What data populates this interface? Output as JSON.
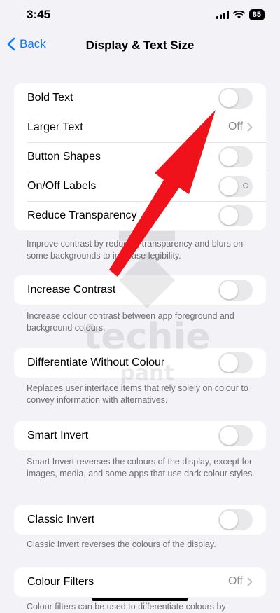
{
  "status": {
    "time": "3:45",
    "battery": "85"
  },
  "nav": {
    "back_label": "Back",
    "title": "Display & Text Size"
  },
  "group1": {
    "bold_text": "Bold Text",
    "larger_text": "Larger Text",
    "larger_text_value": "Off",
    "button_shapes": "Button Shapes",
    "onoff_labels": "On/Off Labels",
    "reduce_transparency": "Reduce Transparency",
    "footer": "Improve contrast by reducing transparency and blurs on some backgrounds to increase legibility."
  },
  "increase_contrast": {
    "label": "Increase Contrast",
    "footer": "Increase colour contrast between app foreground and background colours."
  },
  "differentiate": {
    "label": "Differentiate Without Colour",
    "footer": "Replaces user interface items that rely solely on colour to convey information with alternatives."
  },
  "smart_invert": {
    "label": "Smart Invert",
    "footer": "Smart Invert reverses the colours of the display, except for images, media, and some apps that use dark colour styles."
  },
  "classic_invert": {
    "label": "Classic Invert",
    "footer": "Classic Invert reverses the colours of the display."
  },
  "colour_filters": {
    "label": "Colour Filters",
    "value": "Off",
    "footer": "Colour filters can be used to differentiate colours by"
  },
  "toggles": {
    "bold_text": false,
    "button_shapes": false,
    "onoff_labels": false,
    "reduce_transparency": false,
    "increase_contrast": false,
    "differentiate": false,
    "smart_invert": false,
    "classic_invert": false
  },
  "watermark": {
    "text_line1": "techie",
    "text_line2": "pant"
  },
  "colors": {
    "accent": "#0a7aff",
    "arrow": "#f0121b",
    "background": "#f2f2f7"
  },
  "icons": {
    "back": "chevron-left-icon",
    "chevron": "chevron-right-icon",
    "signal": "signal-icon",
    "wifi": "wifi-icon",
    "battery": "battery-icon",
    "annotation": "red-arrow"
  }
}
